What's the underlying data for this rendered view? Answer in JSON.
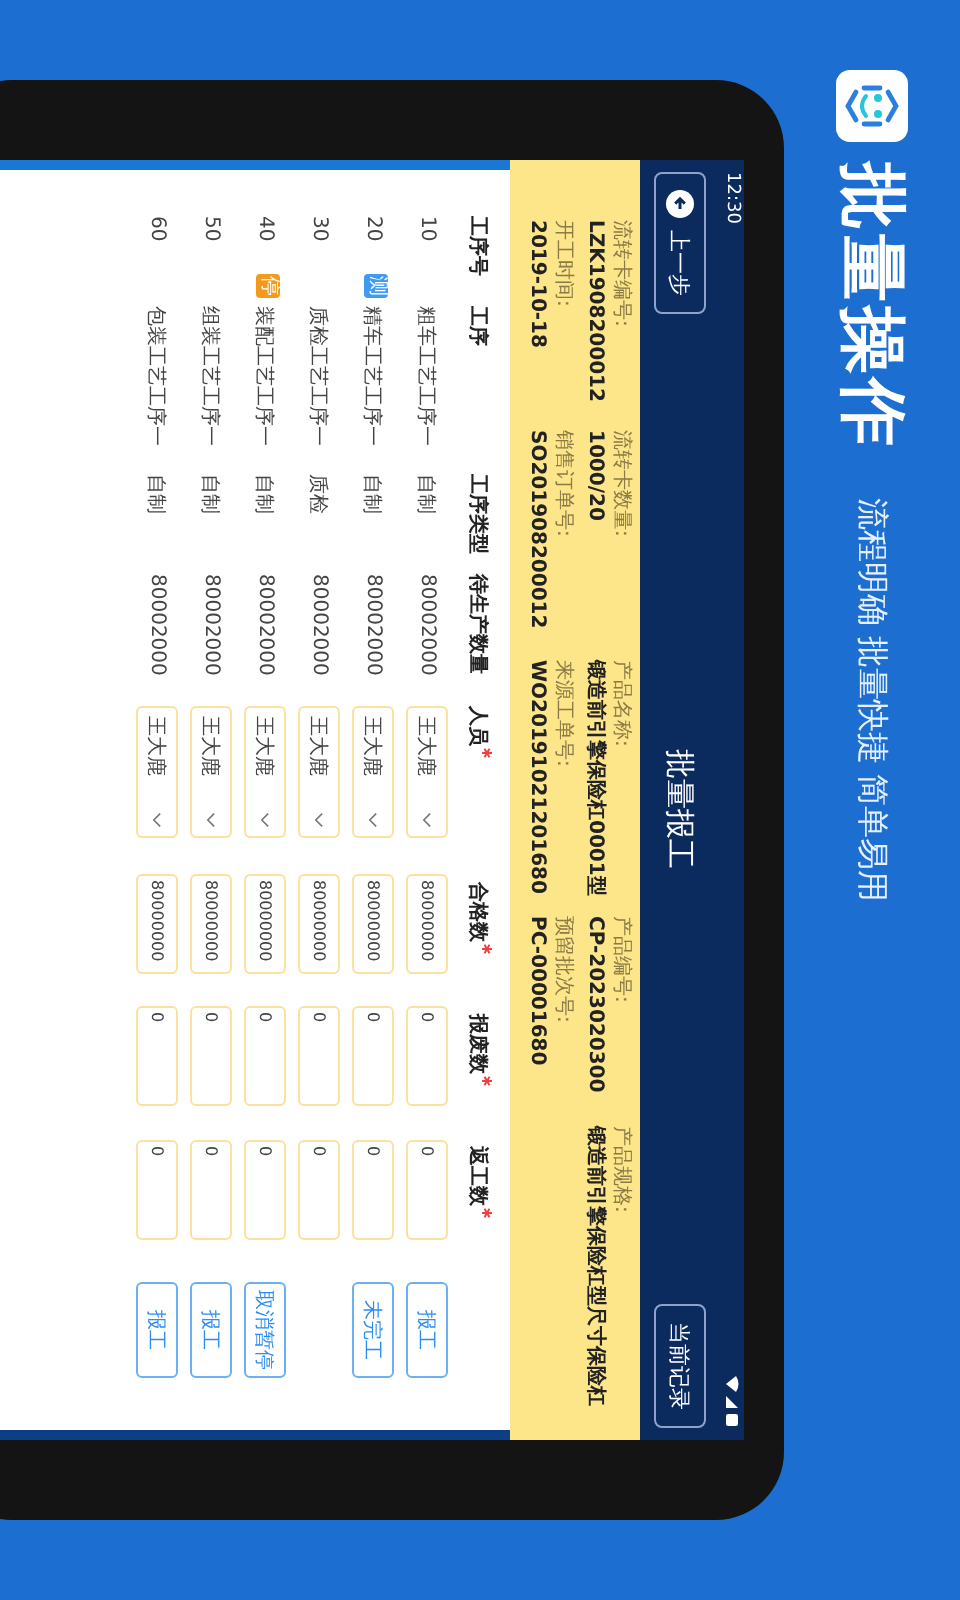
{
  "poster": {
    "title": "批量操作",
    "tagline": "流程明确 批量快捷 简单易用"
  },
  "status_bar": {
    "time": "12:30"
  },
  "title_bar": {
    "back": "上一步",
    "title": "批量报工",
    "records": "当前记录"
  },
  "info": [
    [
      {
        "label": "流转卡编号:",
        "value": "LZK1908200012"
      },
      {
        "label": "流转卡数量:",
        "value": "1000/20"
      },
      {
        "label": "产品名称:",
        "value": "锻造前引擎保险杠0001型"
      },
      {
        "label": "产品编号:",
        "value": "CP-2023020300"
      },
      {
        "label": "产品规格:",
        "value": "锻造前引擎保险杠型尺寸保险杠"
      }
    ],
    [
      {
        "label": "开工时间:",
        "value": "2019-10-18"
      },
      {
        "label": "销售订单号:",
        "value": "SO201908200012"
      },
      {
        "label": "来源工单号:",
        "value": "WO20191021201680"
      },
      {
        "label": "预留批次号:",
        "value": "PC-00001680"
      }
    ]
  ],
  "table": {
    "columns": [
      {
        "label": "工序号",
        "required": false
      },
      {
        "label": "工序",
        "required": false
      },
      {
        "label": "工序类型",
        "required": false
      },
      {
        "label": "待生产数量",
        "required": false
      },
      {
        "label": "人员",
        "required": true
      },
      {
        "label": "合格数",
        "required": true
      },
      {
        "label": "报废数",
        "required": true
      },
      {
        "label": "返工数",
        "required": true
      }
    ],
    "rows": [
      {
        "no": "10",
        "name": "粗车工艺工序一",
        "type": "自制",
        "pending": "80002000",
        "person": "王大鹿",
        "qualified": "80000000",
        "scrap": "0",
        "rework": "0",
        "action": "报工"
      },
      {
        "no": "20",
        "badge": {
          "text": "测",
          "color": "#3d9bf3"
        },
        "name": "精车工艺工序一",
        "type": "自制",
        "pending": "80002000",
        "person": "王大鹿",
        "qualified": "80000000",
        "scrap": "0",
        "rework": "0",
        "action": "未完工"
      },
      {
        "no": "30",
        "name": "质检工艺工序一",
        "type": "质检",
        "pending": "80002000",
        "person": "王大鹿",
        "qualified": "80000000",
        "scrap": "0",
        "rework": "0"
      },
      {
        "no": "40",
        "badge": {
          "text": "停",
          "color": "#f39a1e"
        },
        "name": "装配工艺工序一",
        "type": "自制",
        "pending": "80002000",
        "person": "王大鹿",
        "qualified": "80000000",
        "scrap": "0",
        "rework": "0",
        "action": "取消暂停"
      },
      {
        "no": "50",
        "name": "组装工艺工序一",
        "type": "自制",
        "pending": "80002000",
        "person": "王大鹿",
        "qualified": "80000000",
        "scrap": "0",
        "rework": "0",
        "action": "报工"
      },
      {
        "no": "60",
        "name": "包装工艺工序一",
        "type": "自制",
        "pending": "80002000",
        "person": "王大鹿",
        "qualified": "80000000",
        "scrap": "0",
        "rework": "0",
        "action": "报工"
      }
    ]
  }
}
